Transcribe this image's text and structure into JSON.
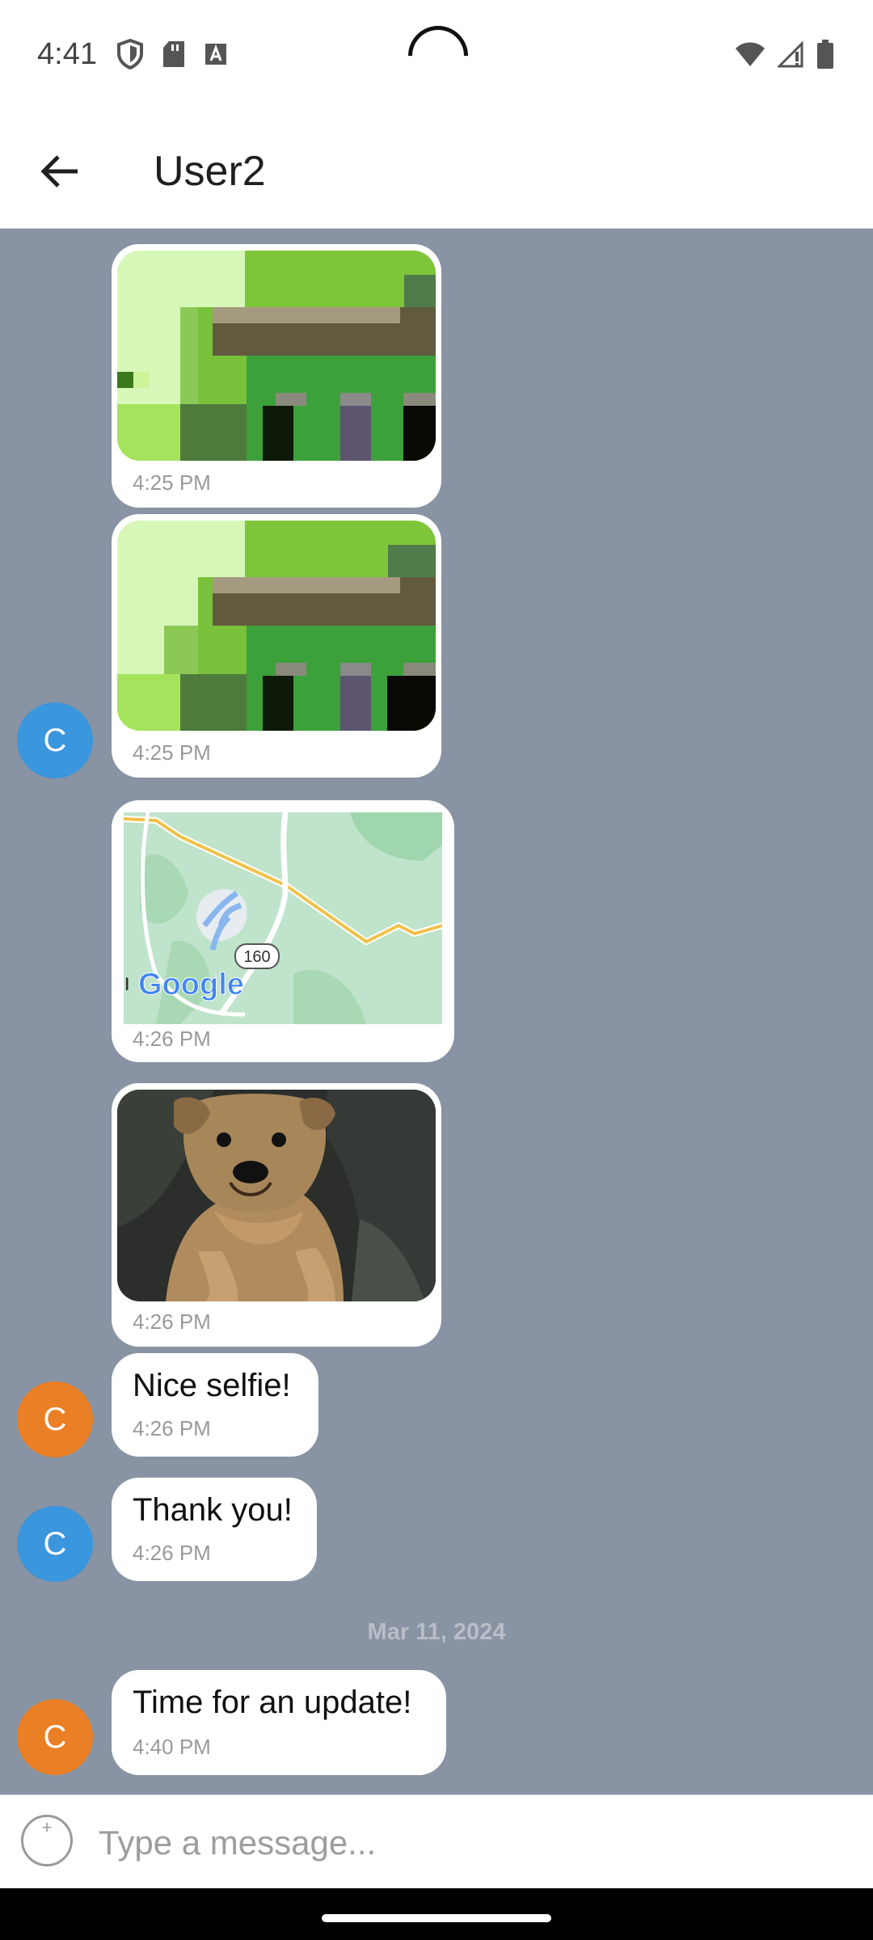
{
  "status_bar": {
    "time": "4:41",
    "left_icons": [
      "shield-icon",
      "sd-card-icon",
      "keyboard-a-icon"
    ],
    "right_icons": [
      "wifi-icon",
      "signal-icon",
      "battery-icon"
    ]
  },
  "app_bar": {
    "title": "User2",
    "back_icon": "arrow-left-icon"
  },
  "avatars": [
    {
      "letter": "C",
      "color": "#3a96dd"
    },
    {
      "letter": "C",
      "color": "#ea7f25"
    },
    {
      "letter": "C",
      "color": "#3a96dd"
    },
    {
      "letter": "C",
      "color": "#ea7f25"
    }
  ],
  "messages": [
    {
      "kind": "image",
      "time": "4:25 PM"
    },
    {
      "kind": "image",
      "time": "4:25 PM"
    },
    {
      "kind": "map",
      "time": "4:26 PM",
      "map_route_label": "160",
      "map_brand": "Google"
    },
    {
      "kind": "image",
      "time": "4:26 PM"
    },
    {
      "kind": "text",
      "text": "Nice selfie!",
      "time": "4:26 PM"
    },
    {
      "kind": "text",
      "text": "Thank you!",
      "time": "4:26 PM"
    },
    {
      "kind": "text",
      "text": "Time for an update!",
      "time": "4:40 PM"
    }
  ],
  "date_separator": "Mar 11, 2024",
  "composer": {
    "placeholder": "Type a message...",
    "add_icon": "plus-circle-icon"
  },
  "colors": {
    "chat_background": "#8893a3",
    "bubble": "#ffffff",
    "avatar_blue": "#3a96dd",
    "avatar_orange": "#ea7f25"
  }
}
